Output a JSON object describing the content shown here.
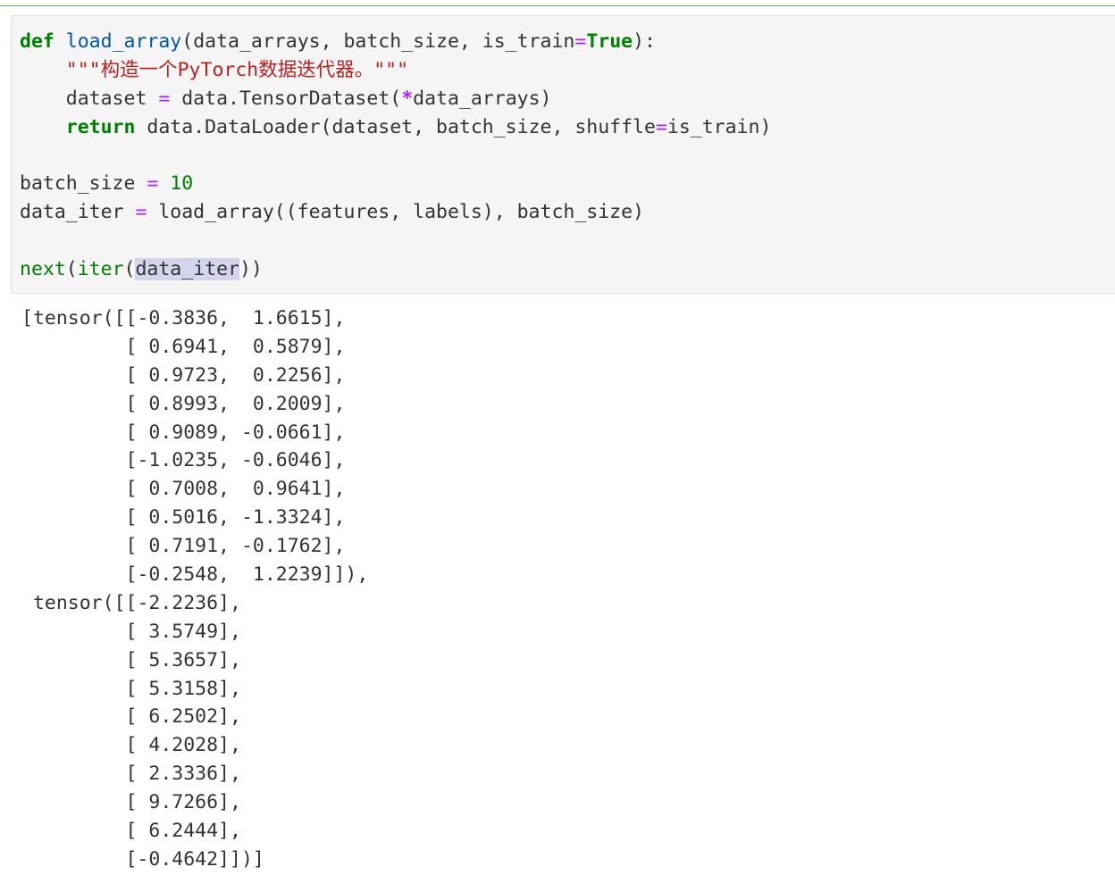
{
  "cell": {
    "kw_def": "def",
    "fn_name": "load_array",
    "params": "(data_arrays, batch_size, is_train",
    "eq": "=",
    "kw_true": "True",
    "params_close": "):",
    "indent": "    ",
    "docstring": "\"\"\"构造一个PyTorch数据迭代器。\"\"\"",
    "line3_a": "dataset ",
    "line3_b": " data.TensorDataset(",
    "star": "*",
    "line3_c": "data_arrays)",
    "kw_return": "return",
    "line4_a": " data.DataLoader(dataset, batch_size, shuffle",
    "line4_b": "is_train)",
    "line6_a": "batch_size ",
    "num_10": "10",
    "line7_a": "data_iter ",
    "line7_b": " load_array((features, labels), batch_size)",
    "bi_next": "next",
    "paren_open": "(",
    "bi_iter": "iter",
    "selected_var": "data_iter",
    "paren_close": "))"
  },
  "output_lines": [
    "[tensor([[-0.3836,  1.6615],",
    "         [ 0.6941,  0.5879],",
    "         [ 0.9723,  0.2256],",
    "         [ 0.8993,  0.2009],",
    "         [ 0.9089, -0.0661],",
    "         [-1.0235, -0.6046],",
    "         [ 0.7008,  0.9641],",
    "         [ 0.5016, -1.3324],",
    "         [ 0.7191, -0.1762],",
    "         [-0.2548,  1.2239]]),",
    " tensor([[-2.2236],",
    "         [ 3.5749],",
    "         [ 5.3657],",
    "         [ 5.3158],",
    "         [ 6.2502],",
    "         [ 4.2028],",
    "         [ 2.3336],",
    "         [ 9.7266],",
    "         [ 6.2444],",
    "         [-0.4642]])]"
  ],
  "colors": {
    "keyword": "#008000",
    "function_name": "#0055aa",
    "operator": "#aa22ff",
    "string": "#ba2121",
    "selection": "#d4d4ed",
    "cell_background": "#f5f5f5",
    "cell_top_rule": "#66bb6a"
  }
}
